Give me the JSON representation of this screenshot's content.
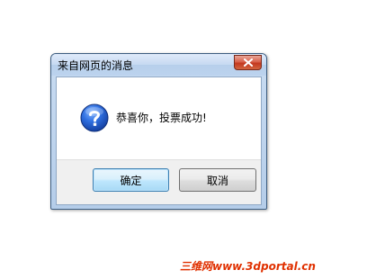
{
  "dialog": {
    "title": "来自网页的消息",
    "message": "恭喜你，投票成功!",
    "icon": "question-icon",
    "ok_label": "确定",
    "cancel_label": "取消",
    "close_icon": "close-icon"
  },
  "watermark": {
    "text": "三维网www.3dportal.cn"
  },
  "colors": {
    "close_button": "#c83b22",
    "ok_border": "#3c7fb1",
    "watermark": "#e03000"
  }
}
